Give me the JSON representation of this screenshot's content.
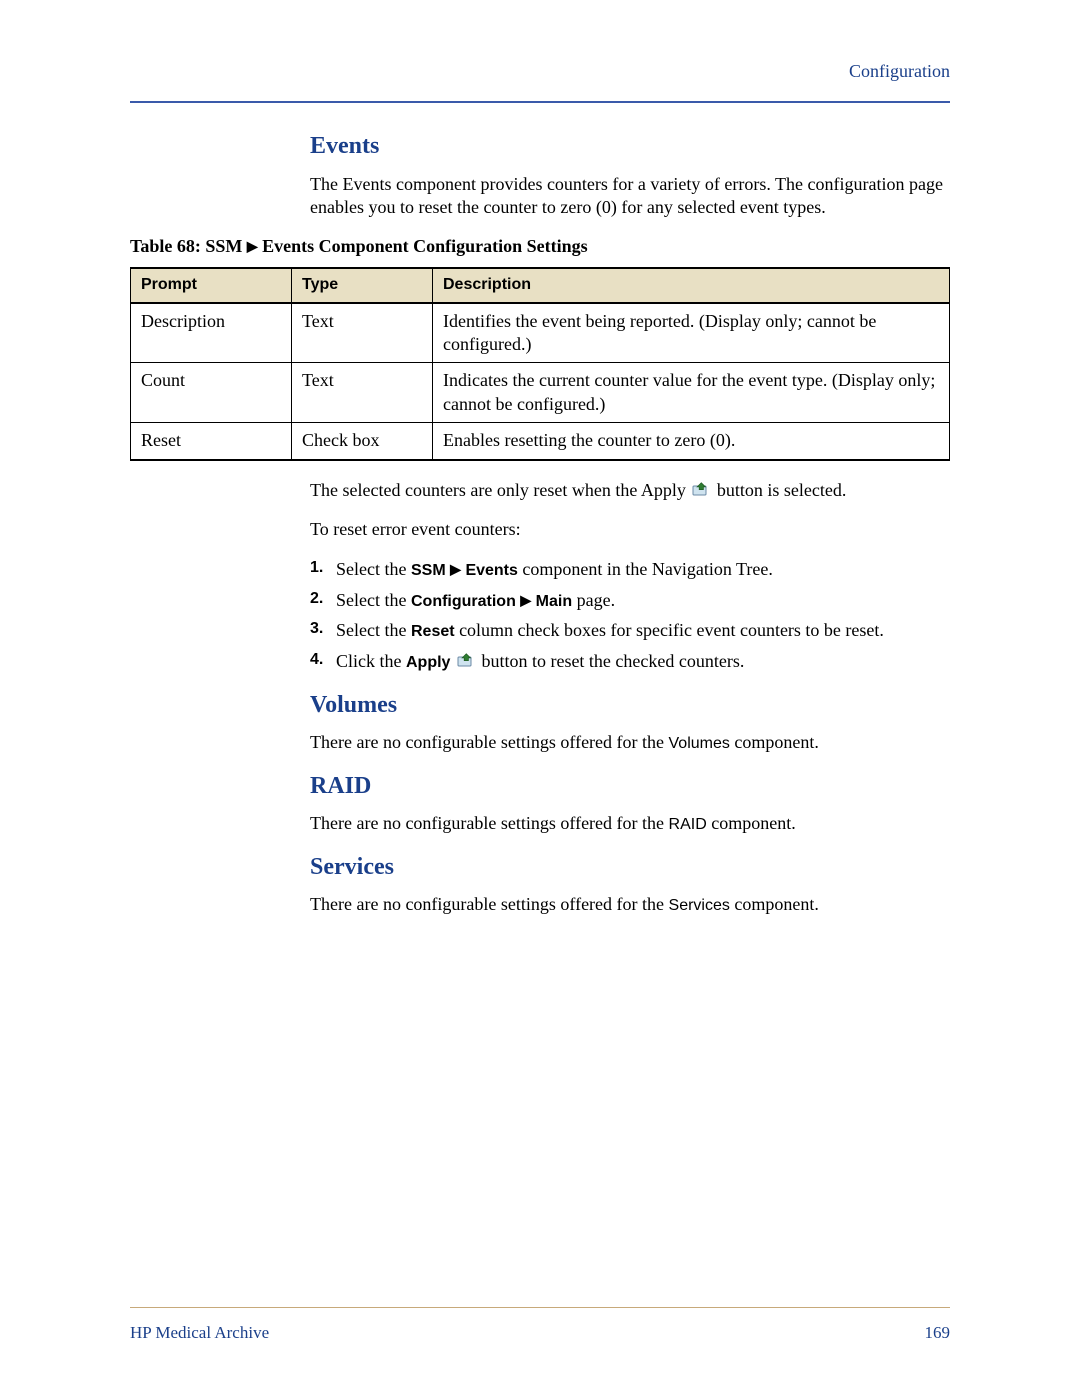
{
  "header": {
    "section_label": "Configuration"
  },
  "events": {
    "heading": "Events",
    "intro": "The Events component provides counters for a variety of errors. The configuration page enables you to reset the counter to zero (0) for any selected event types.",
    "table_caption_prefix": "Table 68: SSM",
    "table_caption_suffix": "Events Component Configuration Settings",
    "table": {
      "columns": {
        "prompt": "Prompt",
        "type": "Type",
        "description": "Description"
      },
      "rows": [
        {
          "prompt": "Description",
          "type": "Text",
          "description": "Identifies the event being reported. (Display only; cannot be configured.)"
        },
        {
          "prompt": "Count",
          "type": "Text",
          "description": "Indicates the current counter value for the event type. (Display only; cannot be configured.)"
        },
        {
          "prompt": "Reset",
          "type": "Check box",
          "description": "Enables resetting the counter to zero (0)."
        }
      ]
    },
    "after_table_p1a": "The selected counters are only reset when the Apply",
    "after_table_p1b": "button is selected.",
    "after_table_p2": "To reset error event counters:",
    "steps": {
      "s1_a": "Select the ",
      "s1_b1": "SSM",
      "s1_b2": "Events",
      "s1_c": " component in the Navigation Tree.",
      "s2_a": "Select the ",
      "s2_b1": "Configuration",
      "s2_b2": "Main",
      "s2_c": " page.",
      "s3_a": "Select the ",
      "s3_b": "Reset",
      "s3_c": " column check boxes for specific event counters to be reset.",
      "s4_a": "Click the ",
      "s4_b": "Apply",
      "s4_c": "button to reset the checked counters."
    }
  },
  "volumes": {
    "heading": "Volumes",
    "text_a": "There are no configurable settings offered for the ",
    "text_b": "Volumes",
    "text_c": " component."
  },
  "raid": {
    "heading": "RAID",
    "text_a": "There are no configurable settings offered for the ",
    "text_b": "RAID",
    "text_c": " component."
  },
  "services": {
    "heading": "Services",
    "text_a": "There are no configurable settings offered for the ",
    "text_b": "Services",
    "text_c": " component."
  },
  "footer": {
    "product": "HP Medical Archive",
    "page": "169"
  },
  "glyphs": {
    "triangle": "▶"
  }
}
